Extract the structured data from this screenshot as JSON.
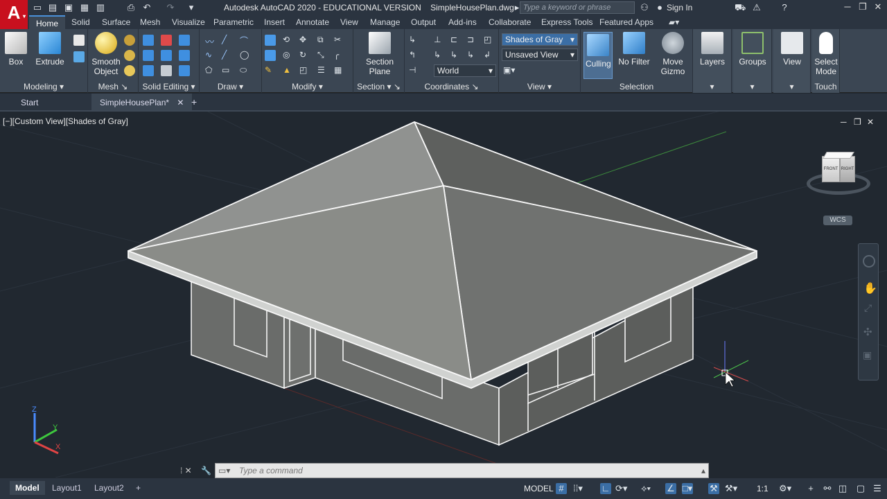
{
  "title_bar": {
    "logo": "A",
    "title": "Autodesk AutoCAD 2020 - EDUCATIONAL VERSION    SimpleHousePlan.dwg",
    "search_placeholder": "Type a keyword or phrase",
    "sign_in": "Sign In"
  },
  "tabs": [
    "Home",
    "Solid",
    "Surface",
    "Mesh",
    "Visualize",
    "Parametric",
    "Insert",
    "Annotate",
    "View",
    "Manage",
    "Output",
    "Add-ins",
    "Collaborate",
    "Express Tools",
    "Featured Apps"
  ],
  "ribbon": {
    "modeling": {
      "title": "Modeling",
      "box": "Box",
      "extrude": "Extrude"
    },
    "mesh": {
      "title": "Mesh",
      "smooth": "Smooth\nObject"
    },
    "solid_editing": {
      "title": "Solid Editing"
    },
    "draw": {
      "title": "Draw"
    },
    "modify": {
      "title": "Modify"
    },
    "section": {
      "title": "Section",
      "plane": "Section\nPlane"
    },
    "coordinates": {
      "title": "Coordinates",
      "world": "World"
    },
    "view": {
      "title": "View",
      "visual_style": "Shades of Gray",
      "named_view": "Unsaved View"
    },
    "selection": {
      "title": "Selection",
      "culling": "Culling",
      "no_filter": "No Filter",
      "move_gizmo": "Move\nGizmo"
    },
    "layers": "Layers",
    "groups": "Groups",
    "view_btn": "View",
    "touch": {
      "title": "Touch",
      "select_mode": "Select\nMode"
    }
  },
  "file_tabs": {
    "start": "Start",
    "current": "SimpleHousePlan*"
  },
  "viewport": {
    "label": "[−][Custom View][Shades of Gray]",
    "viewcube_front": "FRONT",
    "viewcube_right": "RIGHT",
    "wcs": "WCS",
    "axis_z": "Z",
    "axis_y": "Y",
    "axis_x": "X"
  },
  "command_placeholder": "Type a command",
  "layout_tabs": [
    "Model",
    "Layout1",
    "Layout2"
  ],
  "status": {
    "model": "MODEL",
    "scale": "1:1"
  }
}
